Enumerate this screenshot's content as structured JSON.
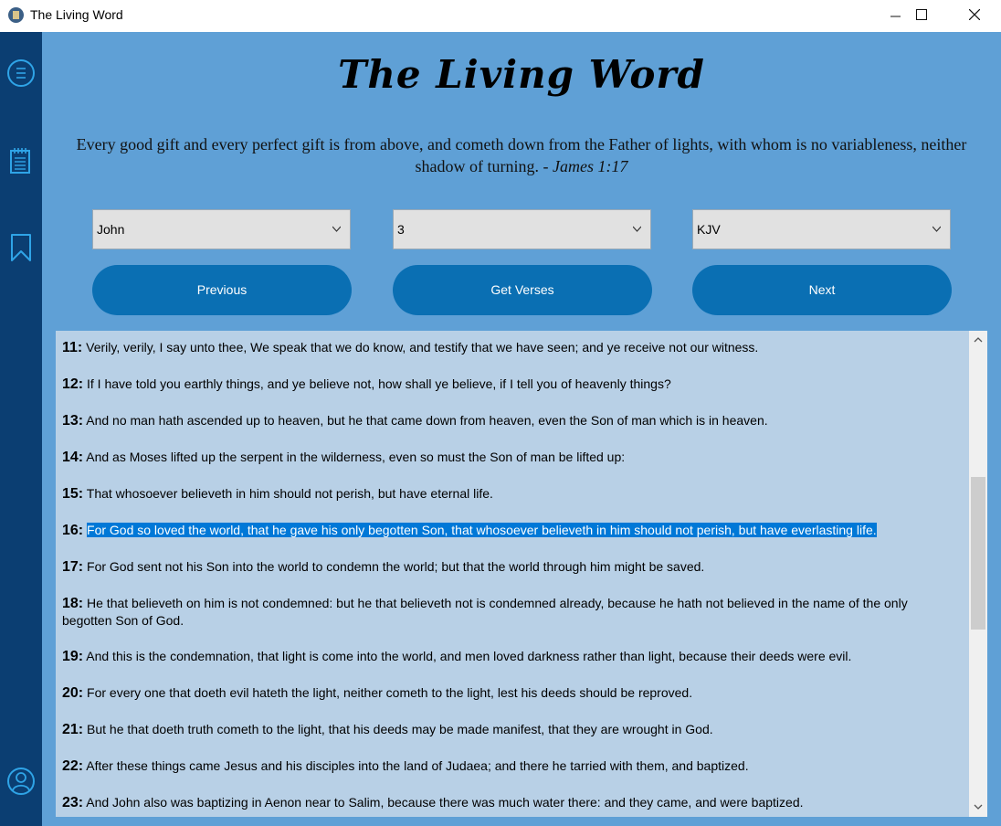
{
  "window": {
    "title": "The Living Word",
    "minimize": "—",
    "maximize": "☐",
    "close": "✕"
  },
  "sidebar": {
    "icons": [
      "menu-icon",
      "notes-icon",
      "bookmark-icon",
      "user-icon"
    ]
  },
  "header": {
    "title": "The Living Word"
  },
  "quote": {
    "text": "Every good gift and every perfect gift is from above, and cometh down from the Father of lights, with whom is no variableness, neither shadow of turning. -",
    "reference": "James 1:17"
  },
  "selectors": {
    "book": "John",
    "chapter": "3",
    "version": "KJV"
  },
  "buttons": {
    "previous": "Previous",
    "get_verses": "Get Verses",
    "next": "Next"
  },
  "verses": [
    {
      "num": "11:",
      "text": "Verily, verily, I say unto thee, We speak that we do know, and testify that we have seen; and ye receive not our witness.",
      "highlighted": false
    },
    {
      "num": "12:",
      "text": "If I have told you earthly things, and ye believe not, how shall ye believe, if I tell you of heavenly things?",
      "highlighted": false
    },
    {
      "num": "13:",
      "text": "And no man hath ascended up to heaven, but he that came down from heaven, even the Son of man which is in heaven.",
      "highlighted": false
    },
    {
      "num": "14:",
      "text": "And as Moses lifted up the serpent in the wilderness, even so must the Son of man be lifted up:",
      "highlighted": false
    },
    {
      "num": "15:",
      "text": "That whosoever believeth in him should not perish, but have eternal life.",
      "highlighted": false
    },
    {
      "num": "16:",
      "text": "For God so loved the world, that he gave his only begotten Son, that whosoever believeth in him should not perish, but have everlasting life.",
      "highlighted": true
    },
    {
      "num": "17:",
      "text": "For God sent not his Son into the world to condemn the world; but that the world through him might be saved.",
      "highlighted": false
    },
    {
      "num": "18:",
      "text": "He that believeth on him is not condemned: but he that believeth not is condemned already, because he hath not believed in the name of the only begotten Son of God.",
      "highlighted": false
    },
    {
      "num": "19:",
      "text": "And this is the condemnation, that light is come into the world, and men loved darkness rather than light, because their deeds were evil.",
      "highlighted": false
    },
    {
      "num": "20:",
      "text": "For every one that doeth evil hateth the light, neither cometh to the light, lest his deeds should be reproved.",
      "highlighted": false
    },
    {
      "num": "21:",
      "text": "But he that doeth truth cometh to the light, that his deeds may be made manifest, that they are wrought in God.",
      "highlighted": false
    },
    {
      "num": "22:",
      "text": "After these things came Jesus and his disciples into the land of Judaea; and there he tarried with them, and baptized.",
      "highlighted": false
    },
    {
      "num": "23:",
      "text": "And John also was baptizing in Aenon near to Salim, because there was much water there: and they came, and were baptized.",
      "highlighted": false
    }
  ]
}
